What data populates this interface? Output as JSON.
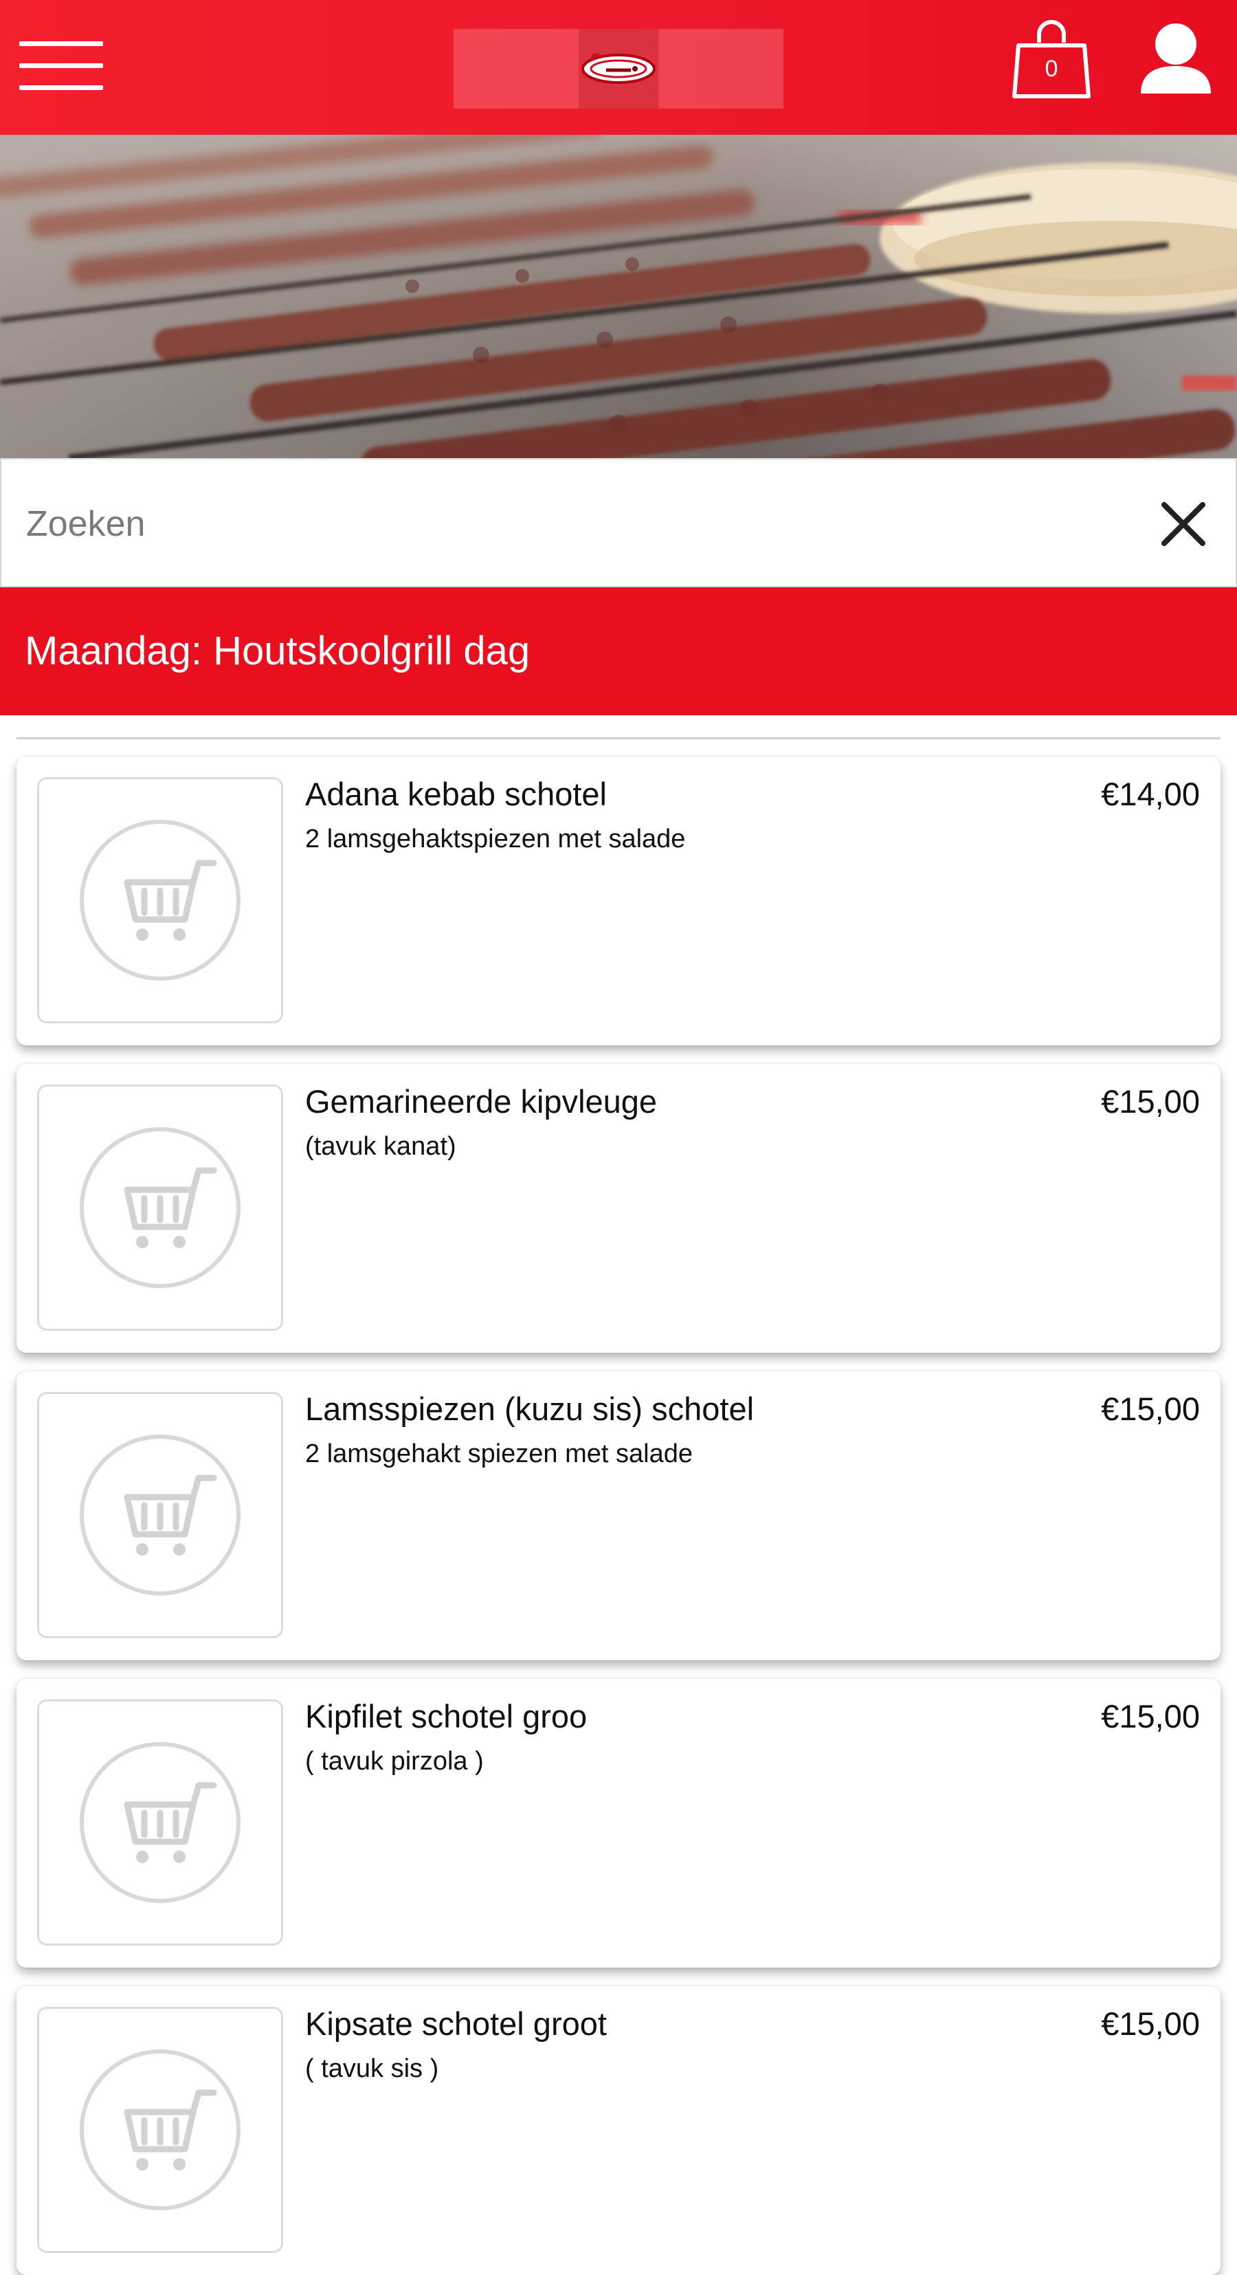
{
  "header": {
    "menu_icon": "hamburger-menu-icon",
    "logo_icon": "restaurant-logo",
    "cart_icon": "shopping-bag-icon",
    "cart_count": "0",
    "account_icon": "user-icon",
    "background_color": "#ee1a2a"
  },
  "hero": {
    "image": "charcoal-grilled-kebab-skewers-photo"
  },
  "search": {
    "placeholder": "Zoeken",
    "value": "",
    "clear_icon": "close-icon"
  },
  "category": {
    "title": "Maandag: Houtskoolgrill dag",
    "background_color": "#e8101f"
  },
  "products": [
    {
      "name": "Adana kebab schotel",
      "description": "2 lamsgehaktspiezen met salade",
      "price": "€14,00",
      "image_icon": "cart-placeholder-icon"
    },
    {
      "name": "Gemarineerde kipvleuge",
      "description": "(tavuk kanat)",
      "price": "€15,00",
      "image_icon": "cart-placeholder-icon"
    },
    {
      "name": "Lamsspiezen (kuzu sis) schotel",
      "description": "2 lamsgehakt spiezen met salade",
      "price": "€15,00",
      "image_icon": "cart-placeholder-icon"
    },
    {
      "name": "Kipfilet schotel groo",
      "description": "( tavuk pirzola )",
      "price": "€15,00",
      "image_icon": "cart-placeholder-icon"
    },
    {
      "name": "Kipsate schotel groot",
      "description": "( tavuk sis )",
      "price": "€15,00",
      "image_icon": "cart-placeholder-icon"
    }
  ]
}
